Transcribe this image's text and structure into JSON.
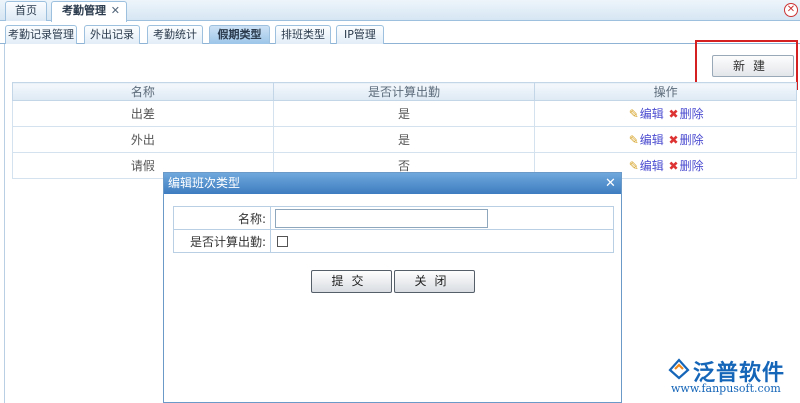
{
  "top_tabs": [
    {
      "label": "首页",
      "active": false
    },
    {
      "label": "考勤管理",
      "active": true,
      "closable": true
    }
  ],
  "top_tab_close_glyph": "✕",
  "window_close_glyph": "✕",
  "sub_tabs": [
    {
      "label": "考勤记录管理"
    },
    {
      "label": "外出记录"
    },
    {
      "label": "考勤统计"
    },
    {
      "label": "假期类型",
      "selected": true
    },
    {
      "label": "排班类型"
    },
    {
      "label": "IP管理"
    }
  ],
  "toolbar": {
    "new_label": "新建"
  },
  "table": {
    "headers": [
      "名称",
      "是否计算出勤",
      "操作"
    ],
    "rows": [
      {
        "name": "出差",
        "count_attendance": "是"
      },
      {
        "name": "外出",
        "count_attendance": "是"
      },
      {
        "name": "请假",
        "count_attendance": "否"
      }
    ],
    "edit_label": "编辑",
    "delete_label": "删除"
  },
  "dialog": {
    "title": "编辑班次类型",
    "name_label": "名称:",
    "name_value": "",
    "attendance_label": "是否计算出勤:",
    "attendance_checked": false,
    "submit_label": "提交",
    "close_label": "关闭"
  },
  "watermark": {
    "brand": "泛普软件",
    "url": "www.fanpusoft.com"
  },
  "colors": {
    "accent": "#3d7cc0",
    "highlight_box": "#d42020",
    "link": "#4a4ad0"
  }
}
